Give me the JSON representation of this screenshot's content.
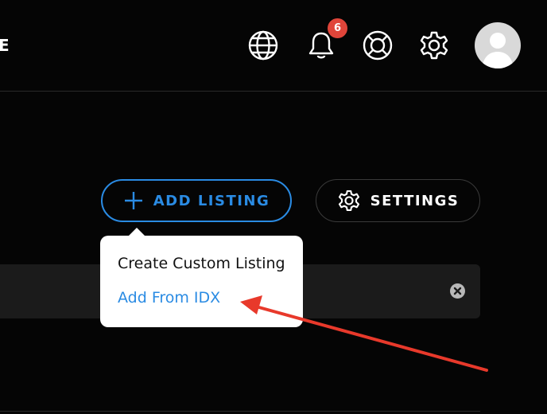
{
  "header": {
    "brand_fragment": "E",
    "notifications_count": "6",
    "icons": [
      "globe-icon",
      "bell-icon",
      "help-lifebuoy-icon",
      "gear-icon",
      "avatar"
    ]
  },
  "toolbar": {
    "add_listing_label": "ADD LISTING",
    "settings_label": "SETTINGS"
  },
  "dropdown": {
    "items": [
      {
        "label": "Create Custom Listing"
      },
      {
        "label": "Add From IDX"
      }
    ]
  },
  "colors": {
    "background": "#050505",
    "accent": "#2a8be3",
    "badge": "#e0453a",
    "annotation_arrow": "#e8392b"
  }
}
